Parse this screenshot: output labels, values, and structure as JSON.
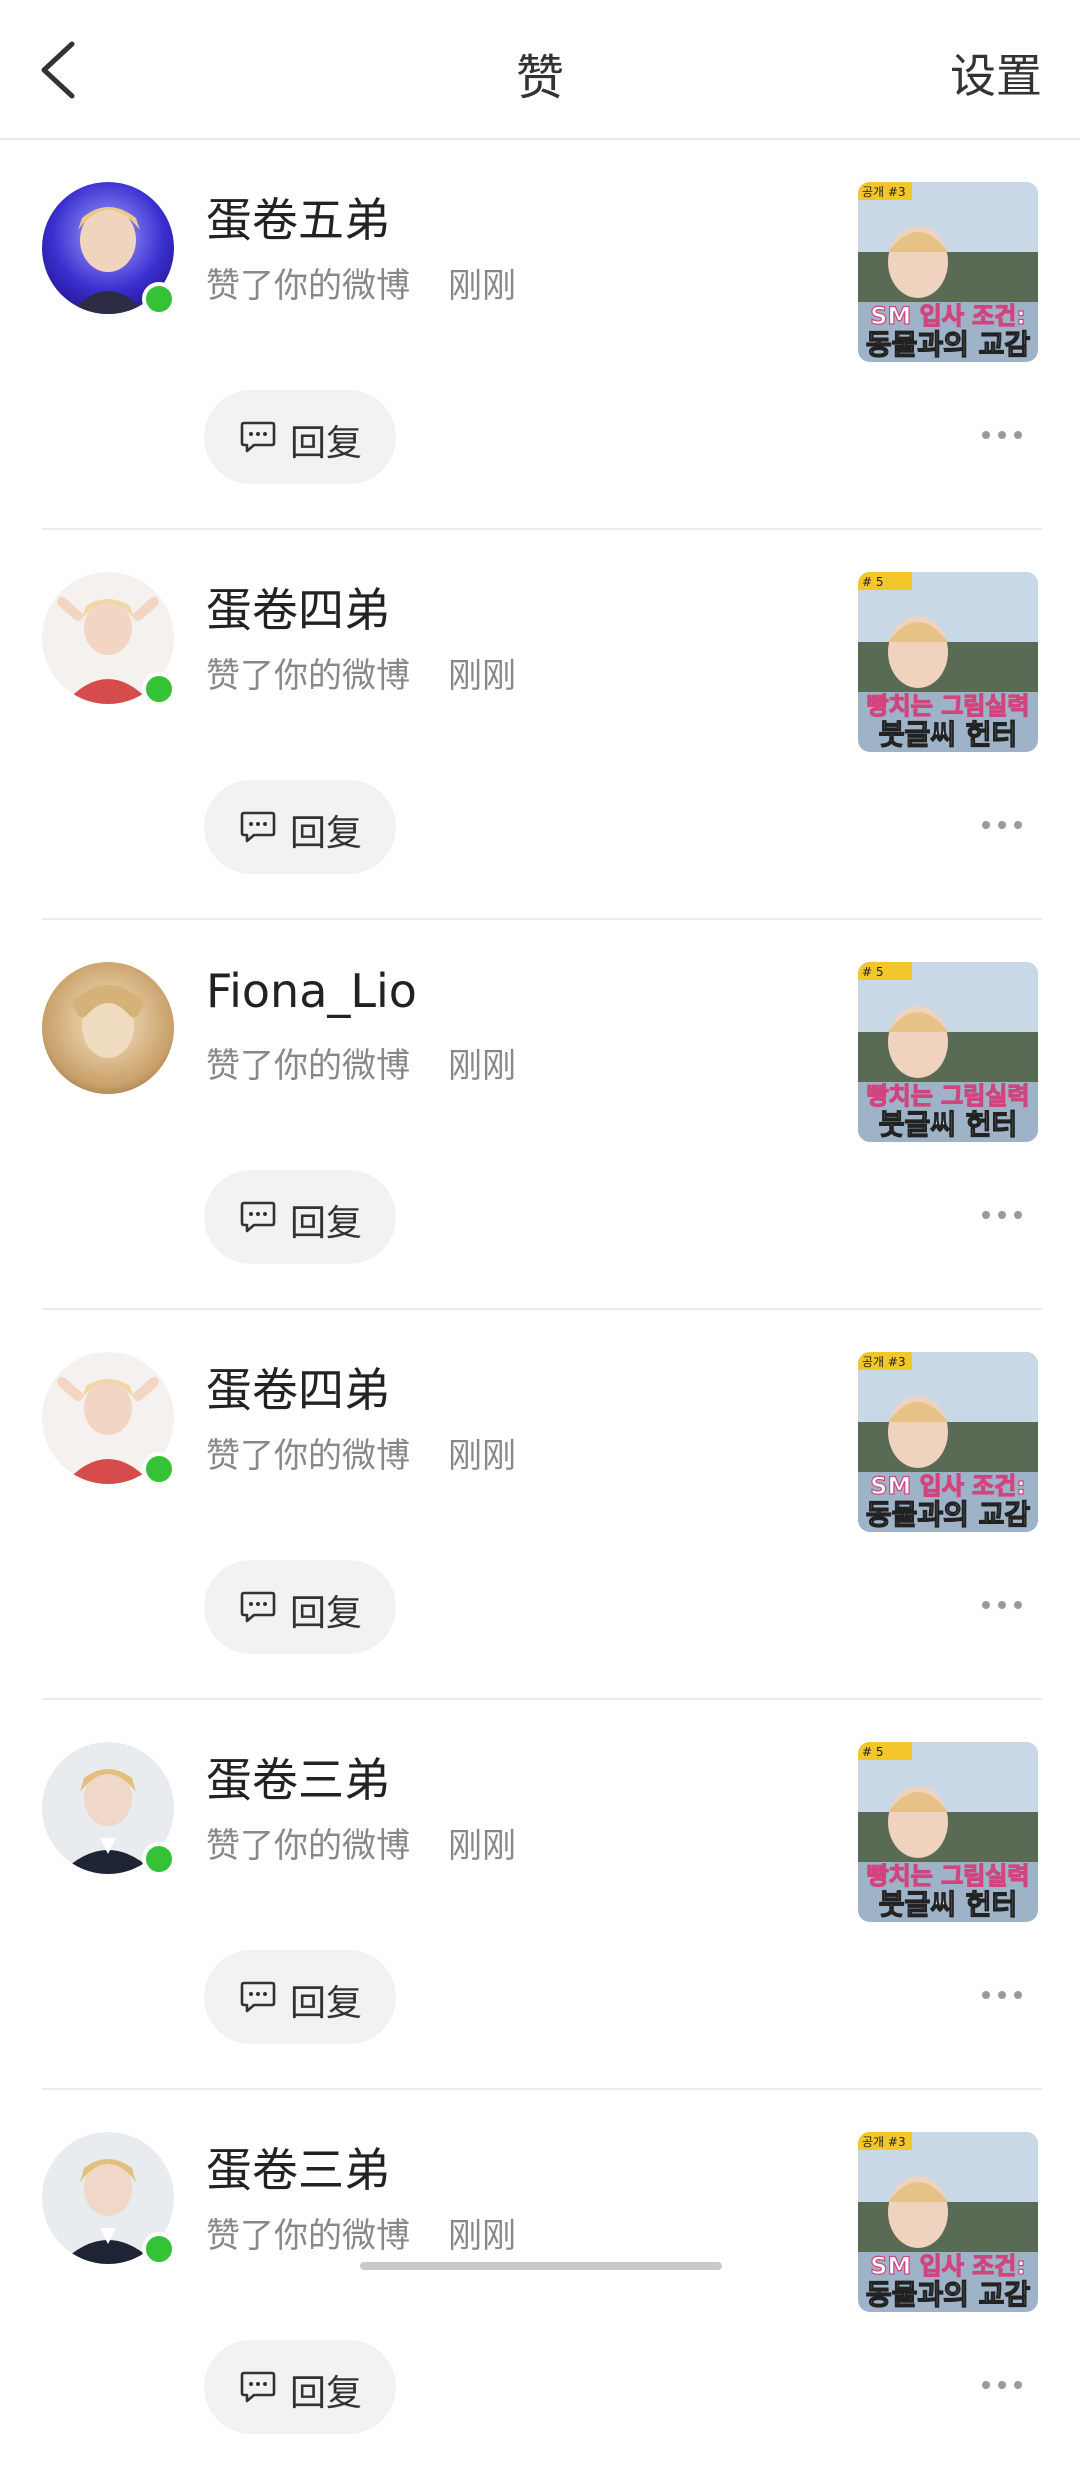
{
  "header": {
    "title": "赞",
    "settings_label": "设置"
  },
  "items": [
    {
      "username": "蛋卷五弟",
      "action": "赞了你的微博",
      "time": "刚刚",
      "reply_label": "回复",
      "online": true,
      "avatar": "avatar-purple-stage",
      "thumb": "thumb-a"
    },
    {
      "username": "蛋卷四弟",
      "action": "赞了你的微博",
      "time": "刚刚",
      "reply_label": "回复",
      "online": true,
      "avatar": "avatar-red-shirt",
      "thumb": "thumb-b"
    },
    {
      "username": "Fiona_Lio",
      "action": "赞了你的微博",
      "time": "刚刚",
      "reply_label": "回复",
      "online": false,
      "avatar": "avatar-golden-statue",
      "thumb": "thumb-b"
    },
    {
      "username": "蛋卷四弟",
      "action": "赞了你的微博",
      "time": "刚刚",
      "reply_label": "回复",
      "online": true,
      "avatar": "avatar-red-shirt",
      "thumb": "thumb-a"
    },
    {
      "username": "蛋卷三弟",
      "action": "赞了你的微博",
      "time": "刚刚",
      "reply_label": "回复",
      "online": true,
      "avatar": "avatar-dark-suit",
      "thumb": "thumb-b"
    },
    {
      "username": "蛋卷三弟",
      "action": "赞了你的微博",
      "time": "刚刚",
      "reply_label": "回复",
      "online": true,
      "avatar": "avatar-dark-suit",
      "thumb": "thumb-a"
    }
  ],
  "thumbnails": {
    "thumb-a": {
      "tag": "공개 #3",
      "line1": "SM 입사 조건:",
      "line2": "동물과의 교감"
    },
    "thumb-b": {
      "tag": "# 5",
      "line1": "빵치는 그림실력",
      "line2": "붓글씨 헌터"
    }
  },
  "colors": {
    "online": "#36c236",
    "accent_text": "#222222",
    "muted_text": "#888888",
    "reply_bg": "#f2f2f2"
  }
}
